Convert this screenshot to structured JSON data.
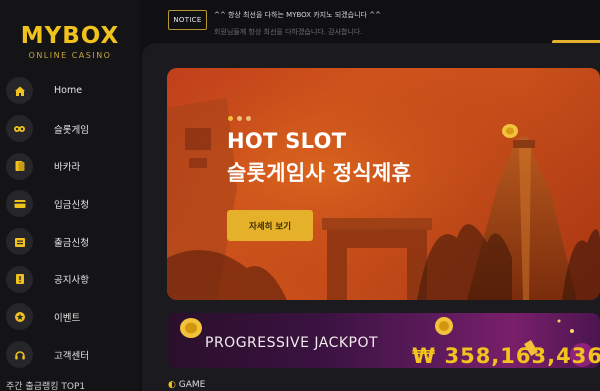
{
  "brand": {
    "name": "MYBOX",
    "subtitle": "ONLINE CASINO"
  },
  "nav": {
    "items": [
      {
        "label": "Home",
        "icon": "home-icon"
      },
      {
        "label": "슬롯게임",
        "icon": "slot-icon"
      },
      {
        "label": "바카라",
        "icon": "cards-icon"
      },
      {
        "label": "입금신청",
        "icon": "card-icon"
      },
      {
        "label": "출금신청",
        "icon": "wallet-icon"
      },
      {
        "label": "공지사항",
        "icon": "notice-icon"
      },
      {
        "label": "이벤트",
        "icon": "star-icon"
      },
      {
        "label": "고객센터",
        "icon": "headset-icon"
      }
    ],
    "sub_label": "주간 출금랭킹 TOP1"
  },
  "notice": {
    "badge": "NOTICE",
    "line1": "^^ 항상 최선을 다하는 MYBOX 카지노 되겠습니다 ^^",
    "line2": "회원님들께 항상 최선을 다하겠습니다. 감사합니다."
  },
  "banner": {
    "headline_1": "HOT SLOT",
    "headline_2": "슬롯게임사 정식제휴",
    "cta_label": "자세히 보기",
    "dots_active": 0,
    "dots_count": 3
  },
  "jackpot": {
    "title": "PROGRESSIVE JACKPOT",
    "amount": "₩ 358,163,436"
  },
  "footer": {
    "peek": "GAME"
  },
  "colors": {
    "accent": "#e5b12a",
    "brand": "#f0c21e",
    "sidebar": "#141417"
  }
}
